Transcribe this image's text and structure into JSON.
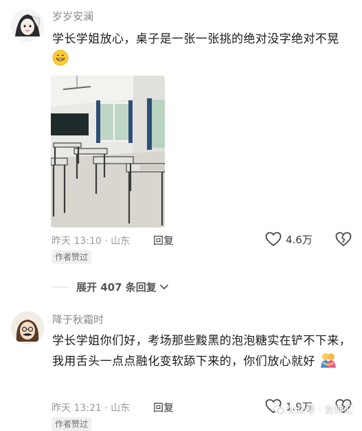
{
  "comments": [
    {
      "username": "岁岁安澜",
      "text": "学长学姐放心，桌子是一张一张挑的绝对没字绝对不晃",
      "emoji_icon": "grinning-face-emoji",
      "photo_icon": "classroom-photo",
      "time": "昨天 13:10",
      "location": "山东",
      "reply_label": "回复",
      "likes": "4.6万",
      "badge": "作者赞过"
    },
    {
      "username": "降于秋霜时",
      "text": "学长学姐你们好，考场那些黢黑的泡泡糖实在铲不下来，我用舌头一点点融化变软舔下来的，你们放心就好",
      "emoji_icon": "hugging-people-emoji",
      "time": "昨天 13:21",
      "location": "山东",
      "reply_label": "回复",
      "likes": "1.9万",
      "badge": "作者赞过"
    }
  ],
  "expand_replies": {
    "label": "展开 407 条回复"
  },
  "watermark": {
    "text": "公众号 · 女神汇"
  }
}
